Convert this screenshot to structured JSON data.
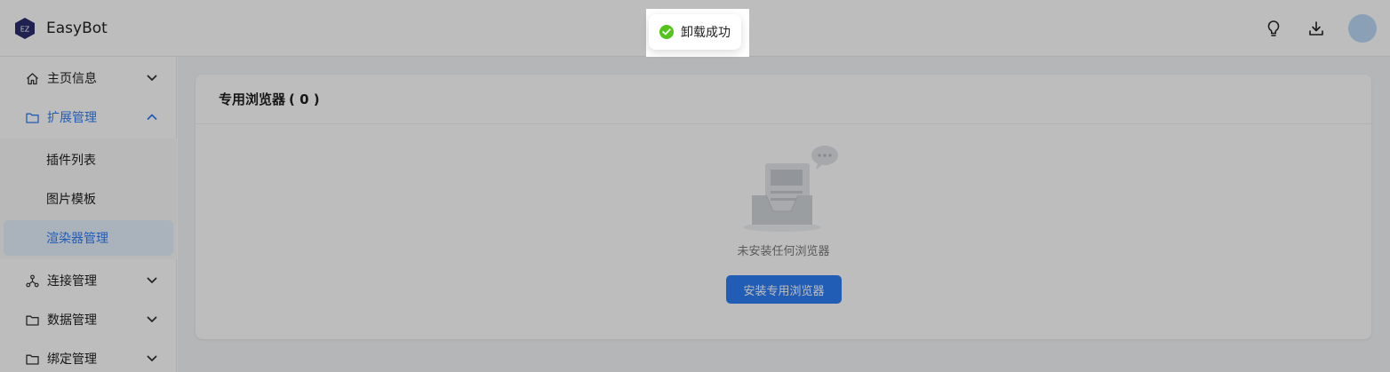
{
  "app": {
    "title": "EasyBot",
    "logo_text": "EZ"
  },
  "header": {
    "icons": [
      "lightbulb-icon",
      "download-icon"
    ],
    "avatar_color": "#b9d8f7"
  },
  "sidebar": {
    "items": [
      {
        "label": "主页信息",
        "icon": "home-icon",
        "expanded": false
      },
      {
        "label": "扩展管理",
        "icon": "folder-icon",
        "expanded": true,
        "children": [
          {
            "label": "插件列表"
          },
          {
            "label": "图片模板"
          },
          {
            "label": "渲染器管理",
            "selected": true
          }
        ]
      },
      {
        "label": "连接管理",
        "icon": "network-icon",
        "expanded": false
      },
      {
        "label": "数据管理",
        "icon": "folder-icon",
        "expanded": false
      },
      {
        "label": "绑定管理",
        "icon": "folder-icon",
        "expanded": false
      }
    ]
  },
  "main": {
    "card_title": "专用浏览器",
    "card_count": "( 0 )",
    "empty_text": "未安装任何浏览器",
    "install_button": "安装专用浏览器"
  },
  "toast": {
    "message": "卸载成功",
    "type": "success"
  },
  "colors": {
    "accent": "#2f7ef5",
    "success": "#52c41a",
    "overlay": "rgba(0,0,0,0.26)"
  }
}
